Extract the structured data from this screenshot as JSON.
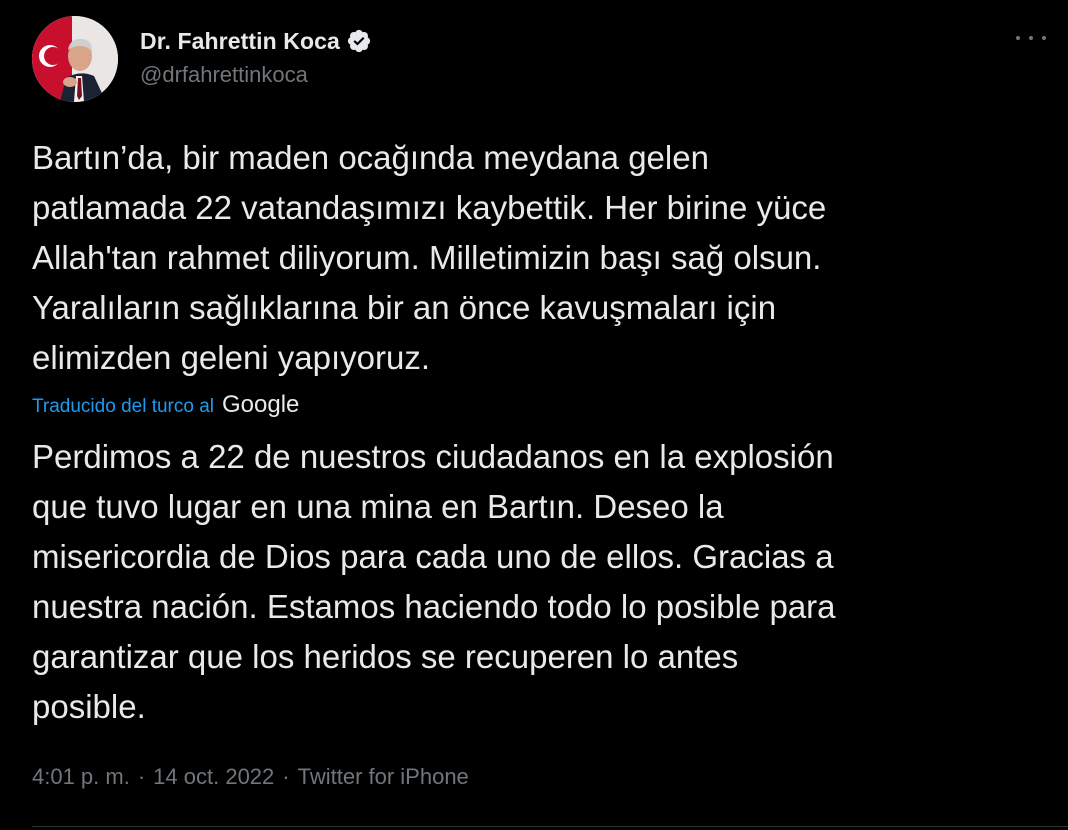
{
  "colors": {
    "background": "#000000",
    "primary_text": "#e7e9ea",
    "secondary_text": "#71767b",
    "link": "#1d9bf0",
    "verified_badge": "#e7e9ea"
  },
  "author": {
    "display_name": "Dr. Fahrettin Koca",
    "handle": "@drfahrettinkoca",
    "verified": true,
    "avatar_icon": "profile-photo"
  },
  "tweet": {
    "original_text": "Bartın’da, bir maden ocağında meydana gelen\npatlamada 22 vatandaşımızı kaybettik. Her birine yüce\nAllah'tan rahmet diliyorum. Milletimizin başı sağ olsun.\nYaralıların sağlıklarına bir an önce kavuşmaları için\nelimizden geleni yapıyoruz.",
    "translation_label": "Traducido del turco al",
    "translation_provider": "Google",
    "translated_text": "Perdimos a 22 de nuestros ciudadanos en la explosión\nque tuvo lugar en una mina en Bartın. Deseo la\nmisericordia de Dios para cada uno de ellos. Gracias a\nnuestra nación. Estamos haciendo todo lo posible para\ngarantizar que los heridos se recuperen lo antes\nposible."
  },
  "meta": {
    "time": "4:01 p. m.",
    "separator": "·",
    "date": "14 oct. 2022",
    "source": "Twitter for iPhone"
  },
  "menu": {
    "icon": "more-icon"
  }
}
